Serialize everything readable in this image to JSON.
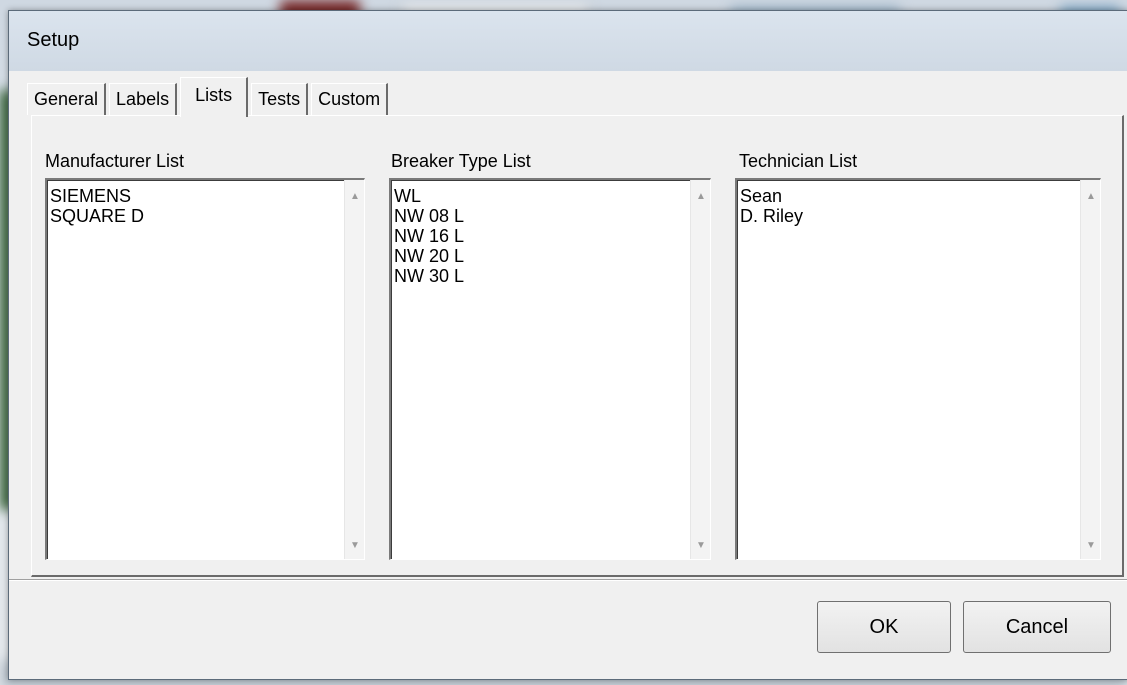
{
  "dialog": {
    "title": "Setup"
  },
  "tabs": [
    {
      "label": "General",
      "active": false
    },
    {
      "label": "Labels",
      "active": false
    },
    {
      "label": "Lists",
      "active": true
    },
    {
      "label": "Tests",
      "active": false
    },
    {
      "label": "Custom",
      "active": false
    }
  ],
  "lists": {
    "manufacturer": {
      "label": "Manufacturer List",
      "items": [
        "SIEMENS",
        "SQUARE D"
      ]
    },
    "breaker_type": {
      "label": "Breaker Type List",
      "items": [
        "WL",
        "NW 08 L",
        "NW 16 L",
        "NW 20 L",
        "NW 30 L"
      ]
    },
    "technician": {
      "label": "Technician List",
      "items": [
        "Sean",
        "D. Riley"
      ]
    }
  },
  "buttons": {
    "ok": "OK",
    "cancel": "Cancel"
  },
  "icons": {
    "scroll_up": "scroll-up-arrow-icon",
    "scroll_down": "scroll-down-arrow-icon"
  },
  "colors": {
    "dialog_bg": "#f0f0f0",
    "titlebar": "#d5dee8"
  }
}
